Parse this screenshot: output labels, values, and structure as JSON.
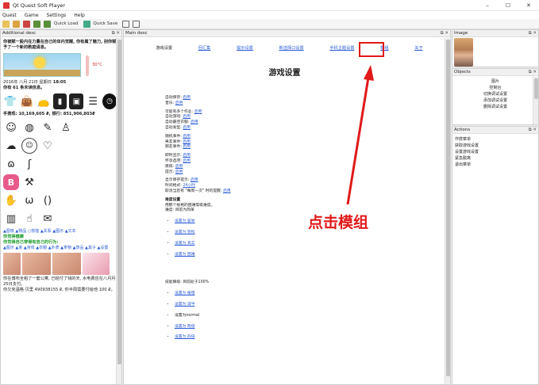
{
  "window": {
    "title": "Qt Quest Soft Player",
    "controls": [
      "–",
      "☐",
      "✕"
    ]
  },
  "menu": [
    "Quest",
    "Game",
    "Settings",
    "Help"
  ],
  "toolbar": {
    "quick_load": "Quick Load",
    "quick_save": "Quick Save"
  },
  "left_panel": {
    "title": "Additional desc",
    "intro": "你被赋一股内在力量在自己的体内觉醒, 你有属了魅力, 别你赋予了一个新的教庭请息。",
    "temperature": "30°C",
    "date": "2016年 八月 21日 星期日",
    "time": "18:05",
    "condition": "你有 61 条未读信息。",
    "cash": "手携现: 10,169,605 ₽, 银行: 851,906,803₽",
    "link_row1": "▲图吸 ▲物品 ○技能 ▲关系 ▲图示 ▲文本",
    "green1": "你觉得健康",
    "green2": "你觉得自己穿得有自己的行为:",
    "link_row2": "▲图示 ▲家 ▲身体 ▲衣服 ▲外表 ▲拿物 ▲饰品 ▲其子 ▲设置",
    "footer1": "你在博布全租了一套公寓, 已经付了钱的天, 水电费应在八月月25日支付。",
    "footer2": "你欠克温格·贝里 490938155 ₽, 你半周需要付给他 100 ₽。"
  },
  "main_panel": {
    "title": "Main desc",
    "nav": [
      "游戏设置",
      "回汇集",
      "提示设置",
      "新选择口设置",
      "手机主题设置",
      "模组",
      "关于"
    ],
    "heading": "游戏设置",
    "annotation": "点击模组",
    "settings": [
      {
        "label": "自动保存: ",
        "value": "启用"
      },
      {
        "label": "音乐: ",
        "value": "启用"
      },
      {
        "label": "可能有多个作业: ",
        "value": "启用"
      },
      {
        "label": "自动游戏: ",
        "value": "启用"
      },
      {
        "label": "自动最佳衣服: ",
        "value": "启用"
      },
      {
        "label": "自动发型: ",
        "value": "启用"
      },
      {
        "label": "随机事件: ",
        "value": "启用"
      },
      {
        "label": "男友事件: ",
        "value": "启用"
      },
      {
        "label": "朋友事件: ",
        "value": "启用"
      },
      {
        "label": "即时显示: ",
        "value": "启用"
      },
      {
        "label": "怀孕选项: ",
        "value": "启用"
      },
      {
        "label": "疾病: ",
        "value": "启用"
      },
      {
        "label": "提示: ",
        "value": "启用"
      },
      {
        "label": "显示保存提示: ",
        "value": "启用"
      },
      {
        "label": "时间格式: ",
        "value": "24小时"
      },
      {
        "label": "取消当您有 \"每周一次\" 时的提醒: ",
        "value": "启用"
      }
    ],
    "difficulty_title": "难度设置",
    "difficulty_desc": "用那个规格的困难等级难度。",
    "difficulty_current": "难度: 目前为简单",
    "difficulty_options": [
      "设置为 容易",
      "设置为 轻松",
      "设置为 真实",
      "设置为 困难"
    ],
    "skill_current": "技能降级: 目前处于100%",
    "skill_options": [
      "设置为 缓慢",
      "设置为 减半",
      "设置为normal",
      "设置为 两倍",
      "设置为 四倍"
    ]
  },
  "image_panel": {
    "title": "Image"
  },
  "objects_panel": {
    "title": "Objects",
    "items": [
      "图片",
      "控制台",
      "切换调试设置",
      "添加调试设置",
      "删除调试设置"
    ]
  },
  "actions_panel": {
    "title": "Actions",
    "items": [
      "作弊菜单",
      "获取游戏设置",
      "设置游戏设置",
      "紧急脱离",
      "退出菜单"
    ]
  }
}
